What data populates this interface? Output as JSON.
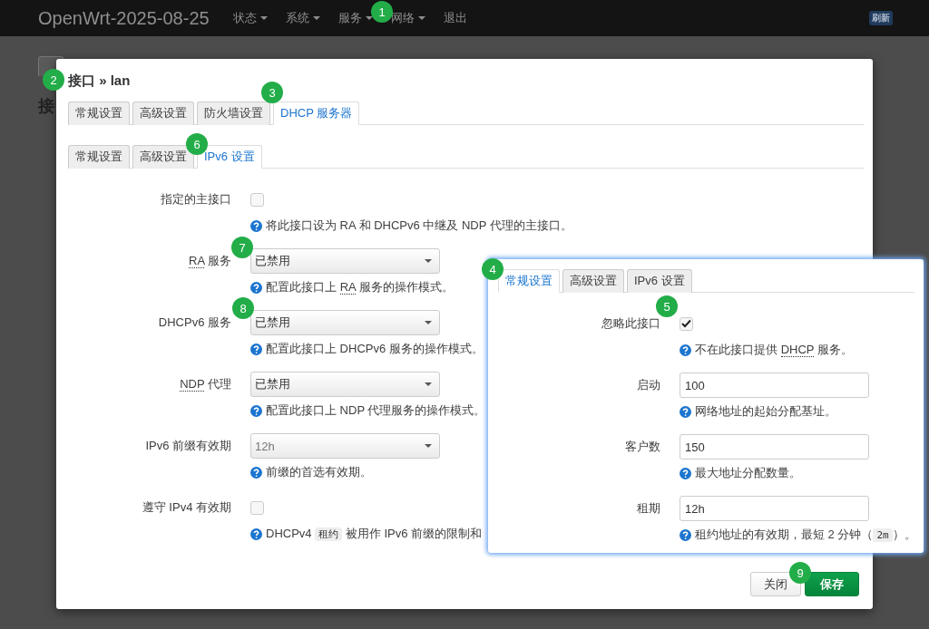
{
  "header": {
    "brand": "OpenWrt-2025-08-25",
    "menu": [
      {
        "label": "状态",
        "dropdown": true
      },
      {
        "label": "系统",
        "dropdown": true
      },
      {
        "label": "服务",
        "dropdown": true
      },
      {
        "label": "网络",
        "dropdown": true
      },
      {
        "label": "退出",
        "dropdown": false
      }
    ],
    "badge": "刷新"
  },
  "background": {
    "heading": "接"
  },
  "dialog": {
    "title": "接口 » lan",
    "tabs": [
      {
        "label": "常规设置",
        "selected": false
      },
      {
        "label": "高级设置",
        "selected": false
      },
      {
        "label": "防火墙设置",
        "selected": false
      },
      {
        "label": "DHCP 服务器",
        "selected": true
      }
    ],
    "subtabs": [
      {
        "label": "常规设置",
        "selected": false
      },
      {
        "label": "高级设置",
        "selected": false
      },
      {
        "label": "IPv6 设置",
        "selected": true
      }
    ],
    "fields": [
      {
        "kind": "checkbox",
        "label": [
          {
            "kind": "text",
            "text": "指定的主接口"
          }
        ],
        "checked": false,
        "help": [
          {
            "kind": "text",
            "text": "将此接口设为 RA 和 DHCPv6 中继及 NDP 代理的主接口。"
          }
        ]
      },
      {
        "kind": "select",
        "label": [
          {
            "kind": "abbr",
            "text": "RA"
          },
          {
            "kind": "text",
            "text": " 服务"
          }
        ],
        "value": "已禁用",
        "disabled": false,
        "help": [
          {
            "kind": "text",
            "text": "配置此接口上 "
          },
          {
            "kind": "abbr",
            "text": "RA"
          },
          {
            "kind": "text",
            "text": " 服务的操作模式。"
          }
        ]
      },
      {
        "kind": "select",
        "label": [
          {
            "kind": "text",
            "text": "DHCPv6 服务"
          }
        ],
        "value": "已禁用",
        "disabled": false,
        "help": [
          {
            "kind": "text",
            "text": "配置此接口上 DHCPv6 服务的操作模式。"
          }
        ]
      },
      {
        "kind": "select",
        "label": [
          {
            "kind": "abbr",
            "text": "NDP"
          },
          {
            "kind": "text",
            "text": " 代理"
          }
        ],
        "value": "已禁用",
        "disabled": false,
        "help": [
          {
            "kind": "text",
            "text": "配置此接口上 NDP 代理服务的操作模式。"
          }
        ]
      },
      {
        "kind": "select",
        "label": [
          {
            "kind": "text",
            "text": "IPv6 前缀有效期"
          }
        ],
        "value": "12h",
        "disabled": true,
        "help": [
          {
            "kind": "text",
            "text": "前缀的首选有效期。"
          }
        ]
      },
      {
        "kind": "checkbox",
        "label": [
          {
            "kind": "text",
            "text": "遵守 IPv4 有效期"
          }
        ],
        "checked": false,
        "help": [
          {
            "kind": "text",
            "text": "DHCPv4 "
          },
          {
            "kind": "code",
            "text": "租约"
          },
          {
            "kind": "text",
            "text": " 被用作 IPv6 前缀的限制和"
          }
        ]
      }
    ],
    "buttons": [
      {
        "label": "关闭",
        "kind": "default"
      },
      {
        "label": "保存",
        "kind": "primary"
      }
    ]
  },
  "panel": {
    "tabs": [
      {
        "label": "常规设置",
        "selected": true
      },
      {
        "label": "高级设置",
        "selected": false
      },
      {
        "label": "IPv6 设置",
        "selected": false
      }
    ],
    "fields": [
      {
        "kind": "checkbox",
        "label": [
          {
            "kind": "text",
            "text": "忽略此接口"
          }
        ],
        "checked": true,
        "help": [
          {
            "kind": "text",
            "text": "不在此接口提供 "
          },
          {
            "kind": "abbr",
            "text": "DHCP"
          },
          {
            "kind": "text",
            "text": " 服务。"
          }
        ]
      },
      {
        "kind": "input",
        "label": [
          {
            "kind": "text",
            "text": "启动"
          }
        ],
        "value": "100",
        "help": [
          {
            "kind": "text",
            "text": "网络地址的起始分配基址。"
          }
        ]
      },
      {
        "kind": "input",
        "label": [
          {
            "kind": "text",
            "text": "客户数"
          }
        ],
        "value": "150",
        "help": [
          {
            "kind": "text",
            "text": "最大地址分配数量。"
          }
        ]
      },
      {
        "kind": "input",
        "label": [
          {
            "kind": "text",
            "text": "租期"
          }
        ],
        "value": "12h",
        "help": [
          {
            "kind": "text",
            "text": "租约地址的有效期，最短 2 分钟（"
          },
          {
            "kind": "code",
            "text": "2m"
          },
          {
            "kind": "text",
            "text": "）。"
          }
        ]
      }
    ]
  },
  "callouts": [
    "1",
    "2",
    "3",
    "4",
    "5",
    "6",
    "7",
    "8",
    "9"
  ]
}
